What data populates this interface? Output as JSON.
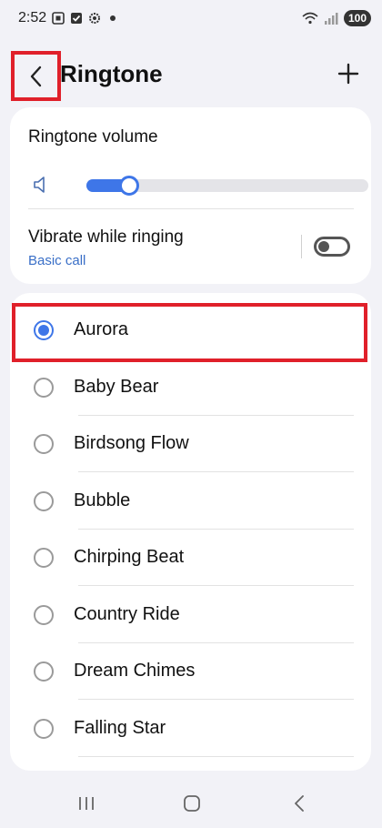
{
  "status_bar": {
    "time": "2:52",
    "battery": "100",
    "icons": [
      "screenshot-icon",
      "check-icon",
      "settings-icon",
      "dot-icon",
      "wifi-icon",
      "signal-icon"
    ]
  },
  "header": {
    "title": "Ringtone",
    "back_icon": "chevron-left-icon",
    "add_icon": "plus-icon"
  },
  "volume": {
    "label": "Ringtone volume",
    "level_percent": 15,
    "icon": "speaker-icon"
  },
  "vibrate": {
    "label": "Vibrate while ringing",
    "sublabel": "Basic call",
    "enabled": false
  },
  "ringtones": [
    {
      "label": "Aurora",
      "selected": true
    },
    {
      "label": "Baby Bear",
      "selected": false
    },
    {
      "label": "Birdsong Flow",
      "selected": false
    },
    {
      "label": "Bubble",
      "selected": false
    },
    {
      "label": "Chirping Beat",
      "selected": false
    },
    {
      "label": "Country Ride",
      "selected": false
    },
    {
      "label": "Dream Chimes",
      "selected": false
    },
    {
      "label": "Falling Star",
      "selected": false
    }
  ],
  "nav_bar": {
    "icons": [
      "recent-apps-icon",
      "home-icon",
      "back-icon"
    ]
  },
  "colors": {
    "accent": "#3e76e8",
    "highlight": "#e0202a",
    "background": "#f2f2f7"
  }
}
